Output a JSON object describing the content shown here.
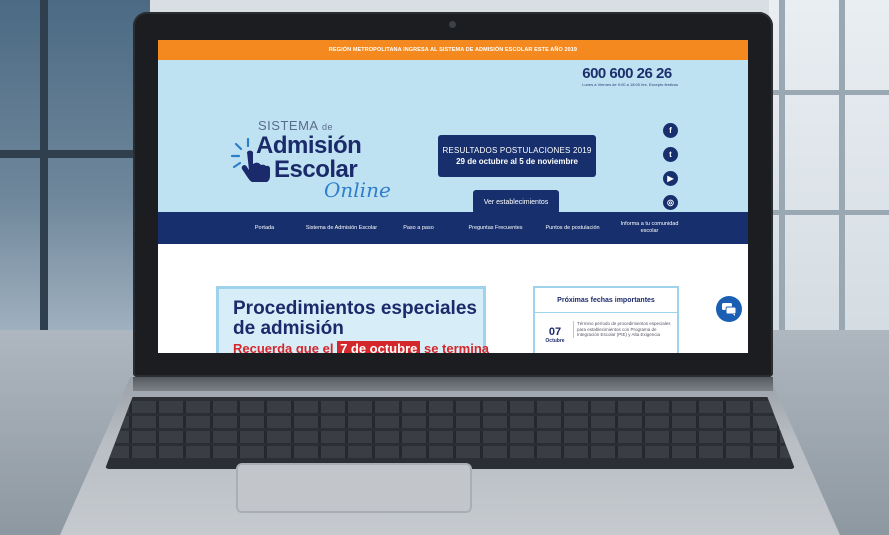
{
  "site": {
    "top_banner": "REGIÓN METROPOLITANA INGRESA AL SISTEMA DE ADMISIÓN ESCOLAR ESTE AÑO 2019",
    "phone": "600 600 26 26",
    "phone_hours": "Lunes a Viernes de 9:00 a 18:00 hrs. Excepto festivos",
    "logo": {
      "line1": "SISTEMA",
      "line1_small": "de",
      "line2": "Admisión",
      "line3": "Escolar",
      "line4": "Online"
    },
    "results": {
      "title": "RESULTADOS POSTULACIONES 2019",
      "dates": "29 de octubre al 5 de noviembre"
    },
    "ver_button": "Ver establecimientos",
    "socials": [
      {
        "icon": "facebook-icon",
        "glyph": "f"
      },
      {
        "icon": "twitter-icon",
        "glyph": "t"
      },
      {
        "icon": "youtube-icon",
        "glyph": "▶"
      },
      {
        "icon": "instagram-icon",
        "glyph": "◎"
      }
    ],
    "nav": [
      "Portada",
      "Sistema de Admisión Escolar",
      "Paso a paso",
      "Preguntas Frecuentes",
      "Puntos de postulación",
      "Informa a tu comunidad escolar"
    ],
    "procedures": {
      "title": "Procedimientos especiales de admisión",
      "reminder_prefix": "Recuerda que el",
      "reminder_date": "7 de octubre",
      "reminder_suffix": "se termina"
    },
    "dates_card": {
      "title": "Próximas fechas importantes",
      "day": "07",
      "month": "Octubre",
      "text": "Término período de procedimientos especiales para establecimientos con Programa de Integración Escolar (PIE) y Alta Exigencia"
    },
    "colors": {
      "banner": "#f4891f",
      "hero": "#bfe2f3",
      "navy": "#17306d",
      "accent_red": "#d4272c"
    }
  }
}
